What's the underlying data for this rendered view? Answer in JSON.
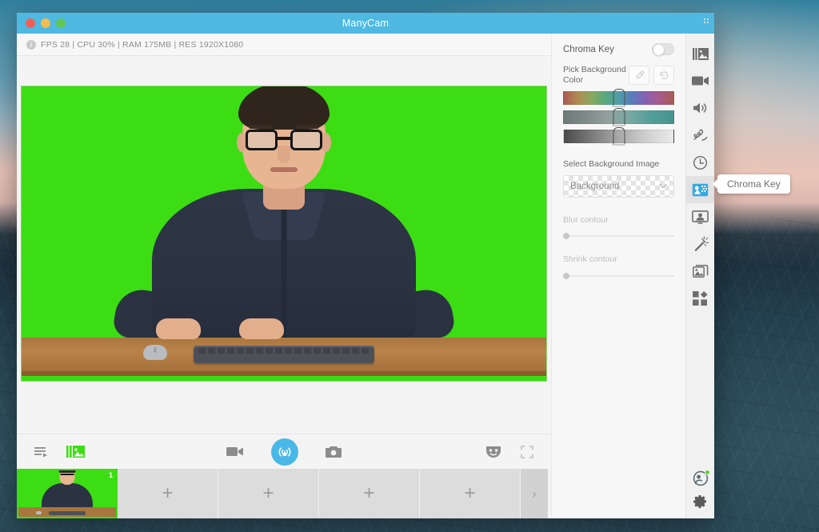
{
  "window": {
    "title": "ManyCam",
    "traffic_lights": [
      "close",
      "minimize",
      "maximize"
    ]
  },
  "status_bar": {
    "text": "FPS 28 | CPU 30% | RAM 175MB | RES 1920X1080",
    "fps": "FPS 28",
    "cpu": "CPU 30%",
    "ram": "RAM 175MB",
    "resolution": "RES 1920X1080",
    "info_icon": "info-icon"
  },
  "video": {
    "chroma_green": "#3ddd14",
    "desk_color": "#a9763f",
    "shirt_color": "#2b3242"
  },
  "toolbar": {
    "left": [
      {
        "name": "playlist-icon",
        "label": "Playlist"
      },
      {
        "name": "media-layers-icon",
        "label": "Media"
      }
    ],
    "center": [
      {
        "name": "video-camera-icon",
        "label": "Record"
      },
      {
        "name": "broadcast-icon",
        "label": "Broadcast"
      },
      {
        "name": "camera-snapshot-icon",
        "label": "Snapshot"
      }
    ],
    "right": [
      {
        "name": "mask-effects-icon",
        "label": "Effects"
      },
      {
        "name": "fullscreen-icon",
        "label": "Fullscreen"
      }
    ],
    "broadcast_color": "#49b8e6"
  },
  "thumbnails": {
    "active_badge": "1",
    "add_label": "+",
    "next_label": "›",
    "slots": [
      "+",
      "+",
      "+",
      "+"
    ]
  },
  "panel": {
    "chroma_key_label": "Chroma Key",
    "chroma_key_enabled": false,
    "pick_background_color_label": "Pick Background Color",
    "eyedropper_name": "eyedropper-icon",
    "reset_name": "reset-icon",
    "sliders": [
      {
        "name": "hue-slider",
        "position": "50%"
      },
      {
        "name": "saturation-slider",
        "position": "50%"
      },
      {
        "name": "lightness-slider",
        "position": "50%"
      }
    ],
    "select_background_image_label": "Select Background Image",
    "background_dropdown_value": "Background",
    "background_dropdown_chevron": "⌄",
    "blur_contour_label": "Blur contour",
    "blur_contour_value": "0",
    "shrink_contour_label": "Shrink contour",
    "shrink_contour_value": "0"
  },
  "rail": {
    "items": [
      {
        "name": "media-playlist-icon",
        "label": "Playlist",
        "active": false
      },
      {
        "name": "video-camera-icon",
        "label": "Video Sources",
        "active": false
      },
      {
        "name": "speaker-icon",
        "label": "Audio",
        "active": false
      },
      {
        "name": "draw-icon",
        "label": "Draw",
        "active": false
      },
      {
        "name": "clock-icon",
        "label": "Timer",
        "active": false
      },
      {
        "name": "chroma-key-icon",
        "label": "Chroma Key",
        "active": true
      },
      {
        "name": "presenter-icon",
        "label": "Presenter",
        "active": false
      },
      {
        "name": "magic-wand-icon",
        "label": "Effects",
        "active": false
      },
      {
        "name": "gallery-icon",
        "label": "Backgrounds",
        "active": false
      },
      {
        "name": "apps-grid-icon",
        "label": "Apps",
        "active": false
      }
    ],
    "bottom": [
      {
        "name": "account-icon",
        "label": "Account",
        "status": "online"
      },
      {
        "name": "gear-icon",
        "label": "Settings"
      }
    ],
    "active_color": "#37a8df"
  },
  "tooltip": {
    "text": "Chroma Key"
  }
}
